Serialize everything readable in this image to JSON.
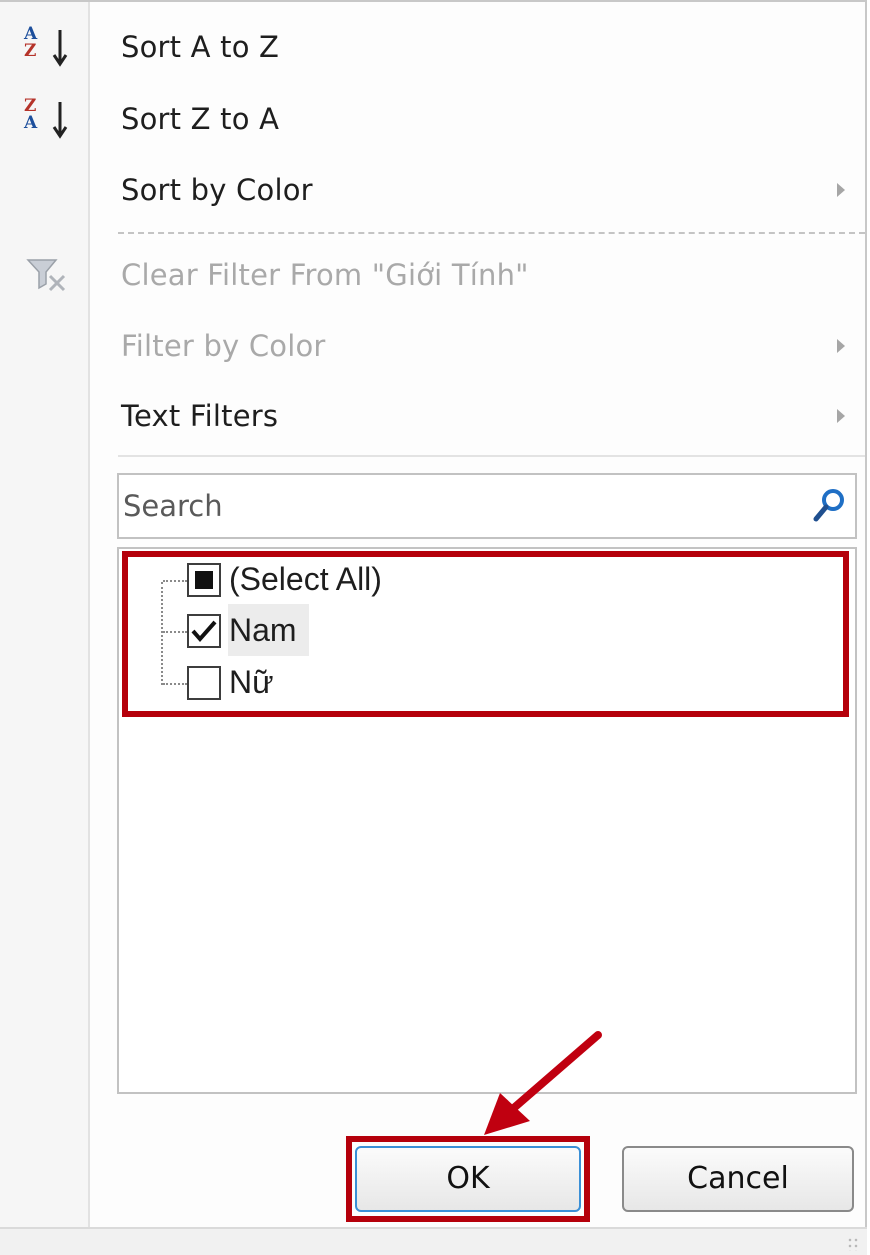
{
  "menu": {
    "sort_az": {
      "label": "Sort A to Z",
      "icon": "sort-a-to-z-icon",
      "icon_letters": [
        "A",
        "Z"
      ]
    },
    "sort_za": {
      "label": "Sort Z to A",
      "icon": "sort-z-to-a-icon",
      "icon_letters": [
        "Z",
        "A"
      ]
    },
    "sort_by_color": {
      "label": "Sort by Color"
    },
    "clear_filter": {
      "label": "Clear Filter From \"Giới Tính\"",
      "icon": "clear-filter-icon",
      "enabled": false
    },
    "filter_by_color": {
      "label": "Filter by Color",
      "enabled": false
    },
    "text_filters": {
      "label": "Text Filters"
    }
  },
  "search": {
    "placeholder": "Search",
    "value": "",
    "icon": "search-icon"
  },
  "filter_list": {
    "items": [
      {
        "label": "(Select All)",
        "state": "partial"
      },
      {
        "label": "Nam",
        "state": "checked"
      },
      {
        "label": "Nữ",
        "state": "unchecked"
      }
    ]
  },
  "buttons": {
    "ok": "OK",
    "cancel": "Cancel"
  },
  "colors": {
    "highlight": "#b5000b",
    "icon_blue": "#1d4f9c",
    "icon_red": "#b5332a",
    "disabled_text": "#a9a9a9",
    "ok_focus_border": "#3a8fd6"
  }
}
